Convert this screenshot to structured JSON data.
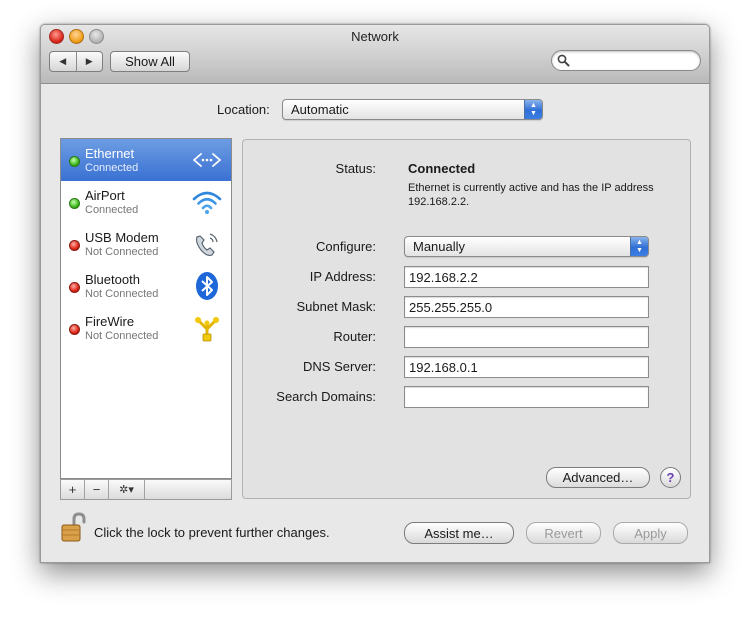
{
  "window": {
    "title": "Network"
  },
  "toolbar": {
    "back_glyph": "◀",
    "forward_glyph": "▶",
    "show_all_label": "Show All",
    "search_value": ""
  },
  "location": {
    "label": "Location:",
    "value": "Automatic"
  },
  "services": [
    {
      "name": "Ethernet",
      "status": "Connected",
      "status_color": "green",
      "icon": "ethernet-icon",
      "selected": true
    },
    {
      "name": "AirPort",
      "status": "Connected",
      "status_color": "green",
      "icon": "airport-wifi-icon",
      "selected": false
    },
    {
      "name": "USB Modem",
      "status": "Not Connected",
      "status_color": "red",
      "icon": "modem-phone-icon",
      "selected": false
    },
    {
      "name": "Bluetooth",
      "status": "Not Connected",
      "status_color": "red",
      "icon": "bluetooth-icon",
      "selected": false
    },
    {
      "name": "FireWire",
      "status": "Not Connected",
      "status_color": "red",
      "icon": "firewire-icon",
      "selected": false
    }
  ],
  "sidebar_tools": {
    "add": "+",
    "remove": "−",
    "gear": "✲▾"
  },
  "detail": {
    "status_label": "Status:",
    "status_value": "Connected",
    "status_description": "Ethernet is currently active and has the IP address 192.168.2.2.",
    "configure_label": "Configure:",
    "configure_value": "Manually",
    "ip_label": "IP Address:",
    "ip_value": "192.168.2.2",
    "subnet_label": "Subnet Mask:",
    "subnet_value": "255.255.255.0",
    "router_label": "Router:",
    "router_value": "",
    "dns_label": "DNS Server:",
    "dns_value": "192.168.0.1",
    "search_domains_label": "Search Domains:",
    "search_domains_value": "",
    "advanced_label": "Advanced…",
    "help_label": "?"
  },
  "footer": {
    "lock_text": "Click the lock to prevent further changes.",
    "assist_label": "Assist me…",
    "revert_label": "Revert",
    "apply_label": "Apply"
  },
  "colors": {
    "selection": "#3a71d3",
    "accent_popup": "#2f6fd6",
    "status_green": "#3cb81b",
    "status_red": "#dd2414"
  }
}
